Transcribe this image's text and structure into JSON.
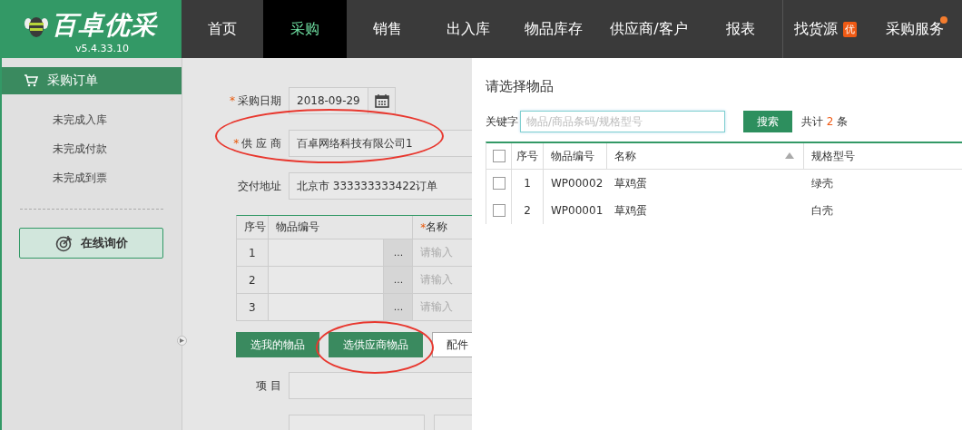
{
  "app": {
    "logo": "百卓优采",
    "version": "v5.4.33.10"
  },
  "nav": [
    {
      "label": "首页",
      "selected": false
    },
    {
      "label": "采购",
      "selected": true
    },
    {
      "label": "销售",
      "selected": false
    },
    {
      "label": "出入库",
      "selected": false
    },
    {
      "label": "物品库存",
      "selected": false
    },
    {
      "label": "供应商/客户",
      "selected": false
    },
    {
      "label": "报表",
      "selected": false
    },
    {
      "label": "找货源",
      "selected": false,
      "badge": "优"
    },
    {
      "label": "采购服务",
      "selected": false,
      "dot": true
    }
  ],
  "sidebar": {
    "section": {
      "label": "采购订单",
      "selected": true
    },
    "items": [
      "未完成入库",
      "未完成付款",
      "未完成到票"
    ],
    "button": "在线询价"
  },
  "form": {
    "fields": [
      {
        "kind": "date",
        "label": "采购日期",
        "value": "2018-09-29",
        "marker": "*",
        "circled": false
      },
      {
        "kind": "text",
        "label": "供 应 商",
        "value": "百卓网络科技有限公司1",
        "marker": "*",
        "circled": true
      },
      {
        "kind": "text",
        "label": "交付地址",
        "value": "北京市 333333333422订单",
        "circled": false
      }
    ],
    "items_table": {
      "columns": [
        {
          "label": "序号"
        },
        {
          "label": "物品编号"
        },
        {
          "label": "名称",
          "marker": "*"
        }
      ],
      "rows": [
        {
          "index": "1",
          "ellipsis": "...",
          "placeholder": "请输入"
        },
        {
          "index": "2",
          "ellipsis": "...",
          "placeholder": "请输入"
        },
        {
          "index": "3",
          "ellipsis": "...",
          "placeholder": "请输入"
        }
      ]
    },
    "buttons": [
      {
        "kind": "primary",
        "label": "选我的物品",
        "circled": false
      },
      {
        "kind": "primary",
        "label": "选供应商物品",
        "circled": true
      },
      {
        "kind": "default",
        "label": "配件",
        "circled": false
      }
    ],
    "project": {
      "label": "项 目"
    }
  },
  "dialog": {
    "title": "请选择物品",
    "keyword_label": "关键字",
    "placeholder": "物品/商品条码/规格型号",
    "search_button": "搜索",
    "total": {
      "prefix": "共计",
      "count": "2",
      "suffix": "条"
    },
    "table": {
      "header_checked": false,
      "columns": [
        {
          "label": "序号",
          "sorted": false
        },
        {
          "label": "物品编号",
          "sorted": false
        },
        {
          "label": "名称",
          "sorted": true
        },
        {
          "label": "规格型号",
          "sorted": false
        }
      ],
      "rows": [
        {
          "checked": false,
          "index": "1",
          "code": "WP00002",
          "name": "草鸡蛋",
          "spec": "绿壳"
        },
        {
          "checked": false,
          "index": "2",
          "code": "WP00001",
          "name": "草鸡蛋",
          "spec": "白壳"
        }
      ]
    }
  }
}
